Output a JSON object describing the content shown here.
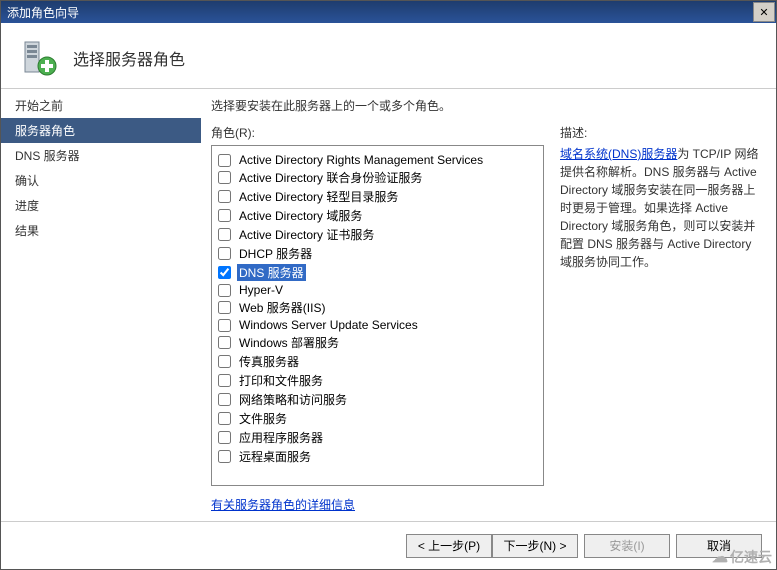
{
  "titlebar": {
    "title": "添加角色向导",
    "close": "✕"
  },
  "header": {
    "title": "选择服务器角色"
  },
  "sidebar": {
    "items": [
      {
        "label": "开始之前",
        "active": false
      },
      {
        "label": "服务器角色",
        "active": true
      },
      {
        "label": "DNS 服务器",
        "active": false
      },
      {
        "label": "确认",
        "active": false
      },
      {
        "label": "进度",
        "active": false
      },
      {
        "label": "结果",
        "active": false
      }
    ]
  },
  "content": {
    "instruction": "选择要安装在此服务器上的一个或多个角色。",
    "roles_label": "角色(R):",
    "roles": [
      {
        "label": "Active Directory Rights Management Services",
        "checked": false,
        "selected": false
      },
      {
        "label": "Active Directory 联合身份验证服务",
        "checked": false,
        "selected": false
      },
      {
        "label": "Active Directory 轻型目录服务",
        "checked": false,
        "selected": false
      },
      {
        "label": "Active Directory 域服务",
        "checked": false,
        "selected": false
      },
      {
        "label": "Active Directory 证书服务",
        "checked": false,
        "selected": false
      },
      {
        "label": "DHCP 服务器",
        "checked": false,
        "selected": false
      },
      {
        "label": "DNS 服务器",
        "checked": true,
        "selected": true
      },
      {
        "label": "Hyper-V",
        "checked": false,
        "selected": false
      },
      {
        "label": "Web 服务器(IIS)",
        "checked": false,
        "selected": false
      },
      {
        "label": "Windows Server Update Services",
        "checked": false,
        "selected": false
      },
      {
        "label": "Windows 部署服务",
        "checked": false,
        "selected": false
      },
      {
        "label": "传真服务器",
        "checked": false,
        "selected": false
      },
      {
        "label": "打印和文件服务",
        "checked": false,
        "selected": false
      },
      {
        "label": "网络策略和访问服务",
        "checked": false,
        "selected": false
      },
      {
        "label": "文件服务",
        "checked": false,
        "selected": false
      },
      {
        "label": "应用程序服务器",
        "checked": false,
        "selected": false
      },
      {
        "label": "远程桌面服务",
        "checked": false,
        "selected": false
      }
    ],
    "help_link": "有关服务器角色的详细信息",
    "desc_title": "描述:",
    "desc_link": "域名系统(DNS)服务器",
    "desc_rest": "为 TCP/IP 网络提供名称解析。DNS 服务器与 Active Directory 域服务安装在同一服务器上时更易于管理。如果选择 Active Directory 域服务角色，则可以安装并配置 DNS 服务器与 Active Directory 域服务协同工作。"
  },
  "footer": {
    "prev": "< 上一步(P)",
    "next": "下一步(N) >",
    "install": "安装(I)",
    "cancel": "取消"
  },
  "watermark": "亿速云"
}
